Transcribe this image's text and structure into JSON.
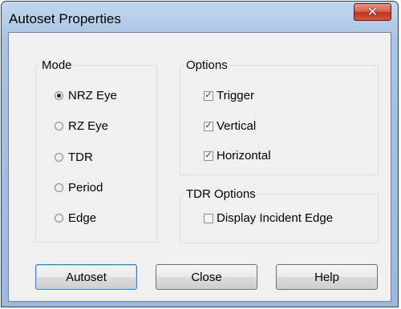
{
  "window": {
    "title": "Autoset Properties",
    "close_glyph": "✕"
  },
  "mode": {
    "legend": "Mode",
    "options": [
      {
        "label": "NRZ Eye",
        "selected": true
      },
      {
        "label": "RZ Eye",
        "selected": false
      },
      {
        "label": "TDR",
        "selected": false
      },
      {
        "label": "Period",
        "selected": false
      },
      {
        "label": "Edge",
        "selected": false
      }
    ]
  },
  "options": {
    "legend": "Options",
    "items": [
      {
        "label": "Trigger",
        "checked": true
      },
      {
        "label": "Vertical",
        "checked": true
      },
      {
        "label": "Horizontal",
        "checked": true
      }
    ]
  },
  "tdr_options": {
    "legend": "TDR Options",
    "items": [
      {
        "label": "Display Incident Edge",
        "checked": false
      }
    ]
  },
  "buttons": {
    "autoset": "Autoset",
    "close": "Close",
    "help": "Help"
  },
  "check_glyph": "✓"
}
